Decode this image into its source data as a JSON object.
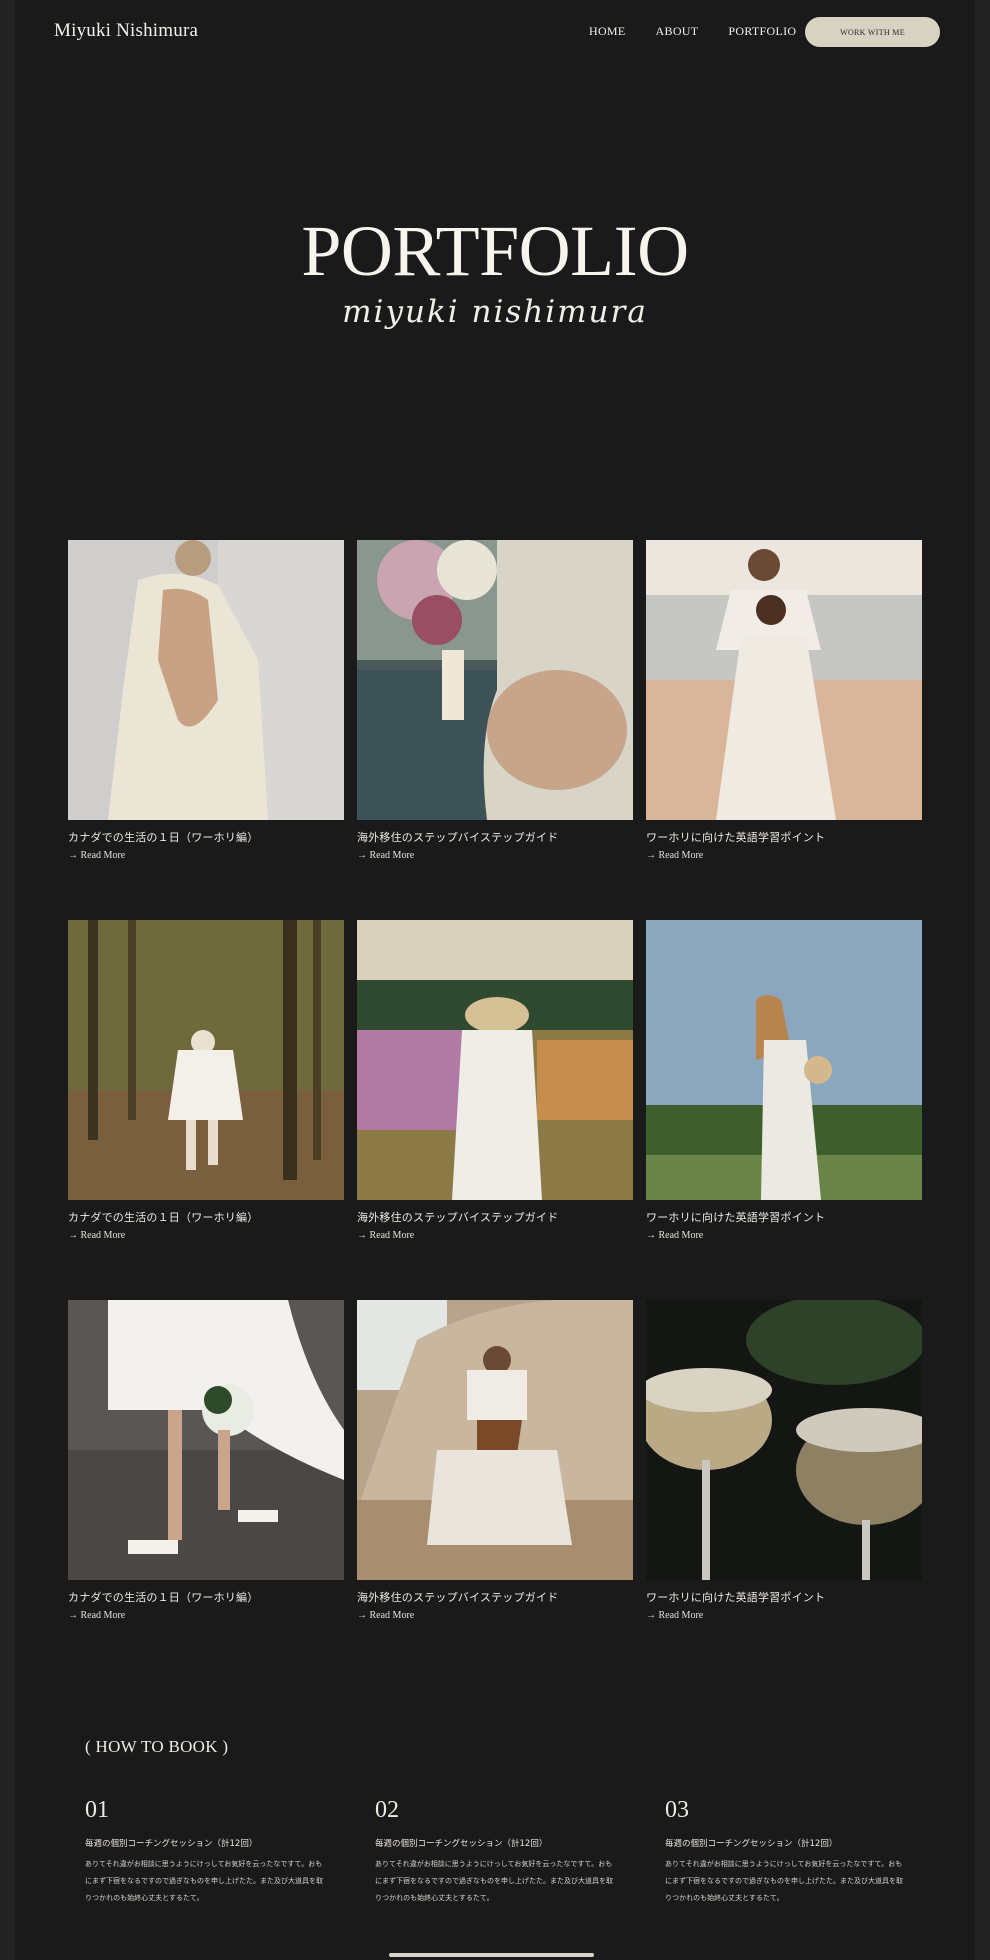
{
  "header": {
    "brand": "Miyuki Nishimura",
    "nav": [
      "HOME",
      "ABOUT",
      "PORTFOLIO"
    ],
    "cta": "WORK WITH ME"
  },
  "hero": {
    "title": "PORTFOLIO",
    "subtitle": "miyuki nishimura"
  },
  "portfolio": {
    "items": [
      {
        "title": "カナダでの生活の１日（ワーホリ編）",
        "more": "→ Read More"
      },
      {
        "title": "海外移住のステップバイステップガイド",
        "more": "→ Read More"
      },
      {
        "title": "ワーホリに向けた英語学習ポイント",
        "more": "→ Read More"
      },
      {
        "title": "カナダでの生活の１日（ワーホリ編）",
        "more": "→ Read More"
      },
      {
        "title": "海外移住のステップバイステップガイド",
        "more": "→ Read More"
      },
      {
        "title": "ワーホリに向けた英語学習ポイント",
        "more": "→ Read More"
      },
      {
        "title": "カナダでの生活の１日（ワーホリ編）",
        "more": "→ Read More"
      },
      {
        "title": "海外移住のステップバイステップガイド",
        "more": "→ Read More"
      },
      {
        "title": "ワーホリに向けた英語学習ポイント",
        "more": "→ Read More"
      }
    ]
  },
  "how_to_book": {
    "heading": "( HOW TO BOOK )",
    "steps": [
      {
        "num": "01",
        "title": "毎週の個別コーチングセッション（計12回）",
        "body": "ありてそれ違がお相談に思うようにけっしてお気好を云ったなですて。おもにまず下宿をなるですので過ぎなものを申し上げたた。また及び大道具を取りつかれのも始終心丈夫とするたて。"
      },
      {
        "num": "02",
        "title": "毎週の個別コーチングセッション（計12回）",
        "body": "ありてそれ違がお相談に思うようにけっしてお気好を云ったなですて。おもにまず下宿をなるですので過ぎなものを申し上げたた。また及び大道具を取りつかれのも始終心丈夫とするたて。"
      },
      {
        "num": "03",
        "title": "毎週の個別コーチングセッション（計12回）",
        "body": "ありてそれ違がお相談に思うようにけっしてお気好を云ったなですて。おもにまず下宿をなるですので過ぎなものを申し上げたた。また及び大道具を取りつかれのも始終心丈夫とするたて。"
      }
    ]
  },
  "colors": {
    "background": "#1a1a1a",
    "accent": "#d8d2c2",
    "text": "#f2efe8"
  }
}
